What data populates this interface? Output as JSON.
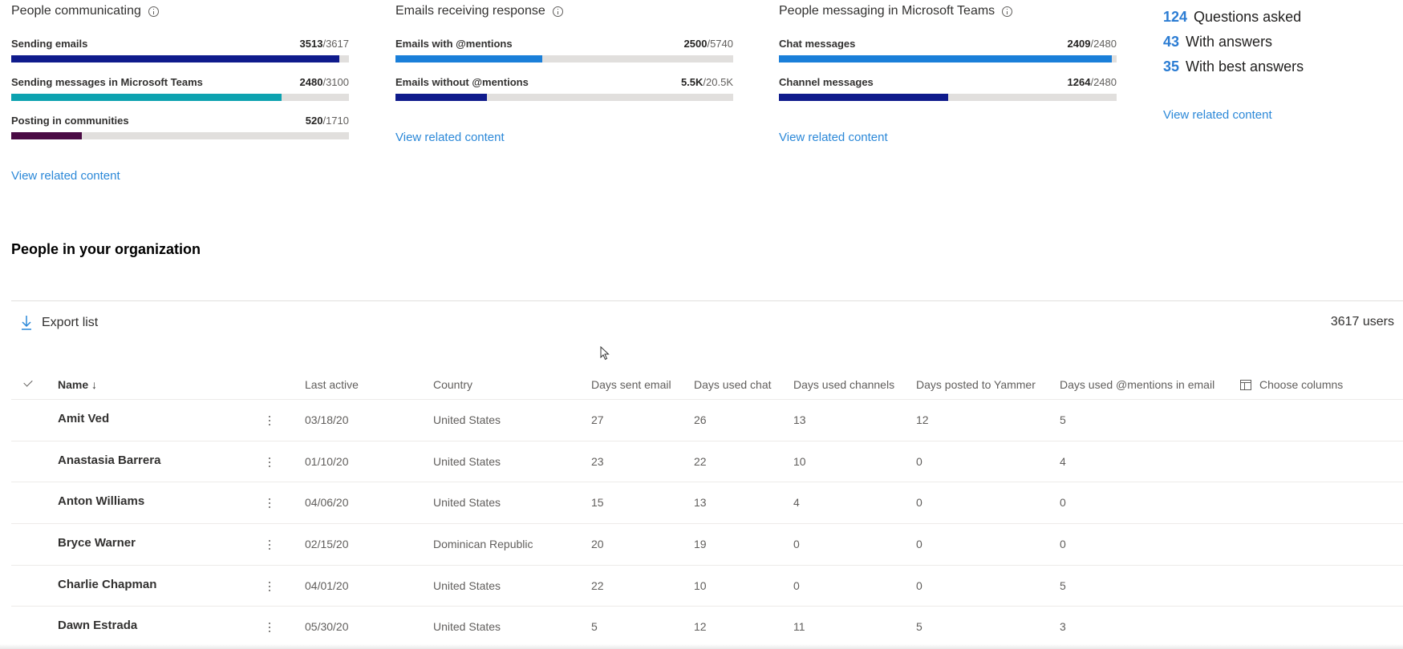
{
  "cards": [
    {
      "title": "People communicating",
      "metrics": [
        {
          "label": "Sending emails",
          "value": "3513",
          "total": "/3617",
          "fraction": 0.971,
          "color": "#0f1b8c"
        },
        {
          "label": "Sending messages in Microsoft Teams",
          "value": "2480",
          "total": "/3100",
          "fraction": 0.8,
          "color": "#0ca2b0"
        },
        {
          "label": "Posting in communities",
          "value": "520",
          "total": "/1710",
          "fraction": 0.21,
          "color": "#4a0b44"
        }
      ],
      "link": "View related content"
    },
    {
      "title": "Emails receiving response",
      "metrics": [
        {
          "label": "Emails with @mentions",
          "value": "2500",
          "total": "/5740",
          "fraction": 0.435,
          "color": "#1a7fd9"
        },
        {
          "label": "Emails without @mentions",
          "value": "5.5K",
          "total": "/20.5K",
          "fraction": 0.27,
          "color": "#0f1b8c"
        }
      ],
      "link": "View related content"
    },
    {
      "title": "People messaging in Microsoft Teams",
      "metrics": [
        {
          "label": "Chat messages",
          "value": "2409",
          "total": "/2480",
          "fraction": 0.985,
          "color": "#1a7fd9"
        },
        {
          "label": "Channel messages",
          "value": "1264",
          "total": "/2480",
          "fraction": 0.5,
          "color": "#0f1b8c"
        }
      ],
      "link": "View related content"
    }
  ],
  "qa": {
    "items": [
      {
        "num": "124",
        "label": "Questions asked"
      },
      {
        "num": "43",
        "label": "With answers"
      },
      {
        "num": "35",
        "label": "With best answers"
      }
    ],
    "link": "View related content"
  },
  "people": {
    "title": "People in your organization",
    "export_label": "Export list",
    "users_count": "3617 users",
    "columns": {
      "name": "Name",
      "last_active": "Last active",
      "country": "Country",
      "days_sent_email": "Days sent email",
      "days_used_chat": "Days used chat",
      "days_used_channels": "Days used channels",
      "days_posted_yammer": "Days posted to Yammer",
      "days_mentions_email": "Days used @mentions in email",
      "choose_columns": "Choose columns"
    },
    "sort_indicator": "↓",
    "rows": [
      {
        "name": "Amit Ved",
        "last_active": "03/18/20",
        "country": "United States",
        "email": "27",
        "chat": "26",
        "channels": "13",
        "yammer": "12",
        "mentions": "5"
      },
      {
        "name": "Anastasia Barrera",
        "last_active": "01/10/20",
        "country": "United States",
        "email": "23",
        "chat": "22",
        "channels": "10",
        "yammer": "0",
        "mentions": "4"
      },
      {
        "name": "Anton Williams",
        "last_active": "04/06/20",
        "country": "United States",
        "email": "15",
        "chat": "13",
        "channels": "4",
        "yammer": "0",
        "mentions": "0"
      },
      {
        "name": "Bryce Warner",
        "last_active": "02/15/20",
        "country": "Dominican Republic",
        "email": "20",
        "chat": "19",
        "channels": "0",
        "yammer": "0",
        "mentions": "0"
      },
      {
        "name": "Charlie Chapman",
        "last_active": "04/01/20",
        "country": "United States",
        "email": "22",
        "chat": "10",
        "channels": "0",
        "yammer": "0",
        "mentions": "5"
      },
      {
        "name": "Dawn Estrada",
        "last_active": "05/30/20",
        "country": "United States",
        "email": "5",
        "chat": "12",
        "channels": "11",
        "yammer": "5",
        "mentions": "3"
      }
    ]
  }
}
